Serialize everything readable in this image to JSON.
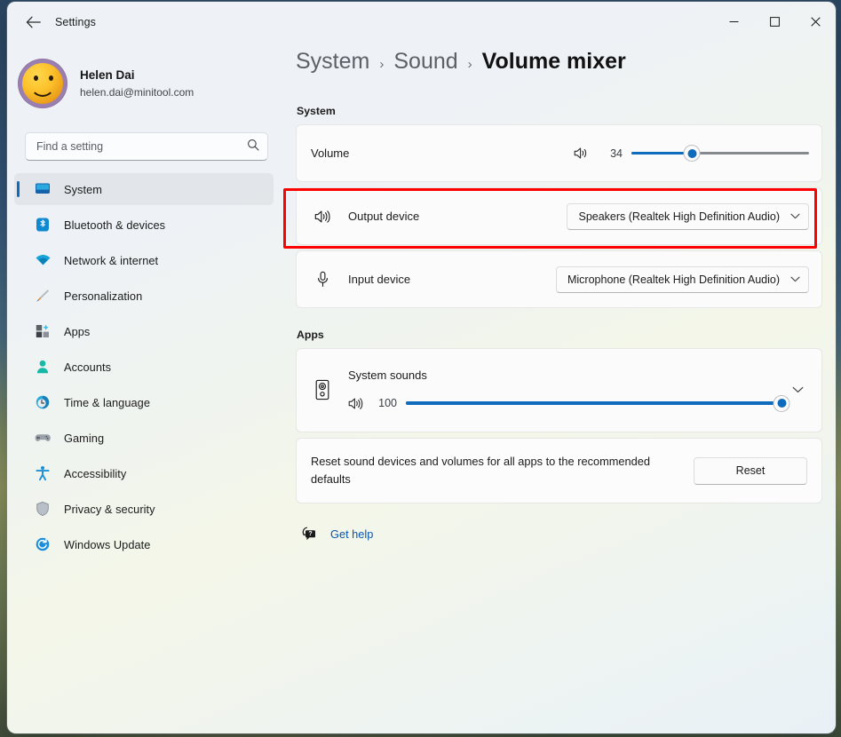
{
  "window": {
    "title": "Settings",
    "back_icon": "back-arrow-icon",
    "minimize_icon": "minimize-icon",
    "maximize_icon": "maximize-icon",
    "close_icon": "close-icon"
  },
  "profile": {
    "name": "Helen Dai",
    "email": "helen.dai@minitool.com",
    "avatar_icon": "smiley-avatar"
  },
  "search": {
    "placeholder": "Find a setting",
    "value": "",
    "icon": "search-icon"
  },
  "sidebar": {
    "items": [
      {
        "label": "System",
        "icon": "monitor-icon",
        "selected": true
      },
      {
        "label": "Bluetooth & devices",
        "icon": "bluetooth-icon",
        "selected": false
      },
      {
        "label": "Network & internet",
        "icon": "wifi-icon",
        "selected": false
      },
      {
        "label": "Personalization",
        "icon": "paintbrush-icon",
        "selected": false
      },
      {
        "label": "Apps",
        "icon": "apps-grid-icon",
        "selected": false
      },
      {
        "label": "Accounts",
        "icon": "person-icon",
        "selected": false
      },
      {
        "label": "Time & language",
        "icon": "clock-icon",
        "selected": false
      },
      {
        "label": "Gaming",
        "icon": "gamepad-icon",
        "selected": false
      },
      {
        "label": "Accessibility",
        "icon": "accessibility-icon",
        "selected": false
      },
      {
        "label": "Privacy & security",
        "icon": "shield-icon",
        "selected": false
      },
      {
        "label": "Windows Update",
        "icon": "update-icon",
        "selected": false
      }
    ]
  },
  "breadcrumb": {
    "crumb1": "System",
    "separator1": "›",
    "crumb2": "Sound",
    "separator2": "›",
    "current": "Volume mixer"
  },
  "system_section": {
    "label": "System",
    "volume": {
      "label": "Volume",
      "icon": "speaker-icon",
      "value": "34",
      "percent": 34,
      "min": 0,
      "max": 100
    },
    "output_device": {
      "label": "Output device",
      "icon": "speaker-waves-icon",
      "selected": "Speakers (Realtek High Definition Audio)",
      "chevron_icon": "chevron-down-icon",
      "highlighted": true
    },
    "input_device": {
      "label": "Input device",
      "icon": "microphone-icon",
      "selected": "Microphone (Realtek High Definition Audio)",
      "chevron_icon": "chevron-down-icon"
    }
  },
  "apps_section": {
    "label": "Apps",
    "system_sounds": {
      "name": "System sounds",
      "icon": "loudspeaker-icon",
      "volume_icon": "speaker-waves-icon",
      "value": "100",
      "percent": 100,
      "expand_icon": "chevron-down-icon"
    },
    "reset": {
      "description": "Reset sound devices and volumes for all apps to the recommended defaults",
      "button_label": "Reset"
    }
  },
  "footer": {
    "get_help_label": "Get help",
    "get_help_icon": "help-question-icon"
  },
  "colors": {
    "accent": "#0f6cbd",
    "link": "#0a56a8",
    "highlight_box": "#ff0000",
    "card_bg": "#fbfbfb"
  }
}
